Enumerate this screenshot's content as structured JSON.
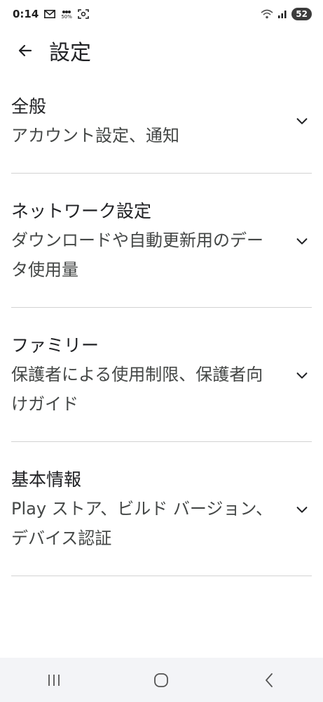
{
  "status_bar": {
    "time": "0:14",
    "battery": "52",
    "icons": [
      "mail-icon",
      "data-saver-icon",
      "screenshot-icon",
      "wifi-icon",
      "signal-icon"
    ],
    "data_saver_label": "50%"
  },
  "header": {
    "title": "設定",
    "back_icon": "arrow-back-icon"
  },
  "sections": [
    {
      "title": "全般",
      "subtitle": "アカウント設定、通知"
    },
    {
      "title": "ネットワーク設定",
      "subtitle": "ダウンロードや自動更新用のデータ使用量"
    },
    {
      "title": "ファミリー",
      "subtitle": "保護者による使用制限、保護者向けガイド"
    },
    {
      "title": "基本情報",
      "subtitle": "Play ストア、ビルド バージョン、デバイス認証"
    }
  ],
  "nav_bar": {
    "icons": [
      "recents-icon",
      "home-icon",
      "back-icon"
    ]
  }
}
